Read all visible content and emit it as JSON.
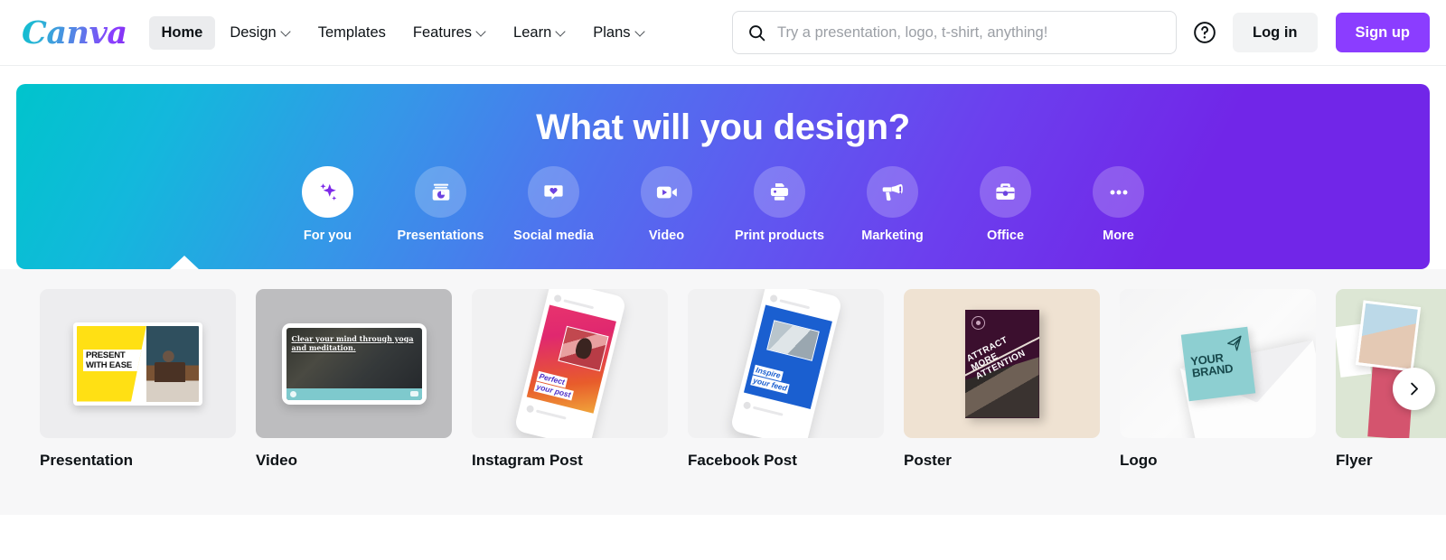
{
  "brand": {
    "logo_text": "Canva",
    "accent_purple": "#8B3DFF",
    "accent_teal": "#00C4CC"
  },
  "header": {
    "nav": [
      {
        "label": "Home",
        "has_caret": false,
        "active": true
      },
      {
        "label": "Design",
        "has_caret": true,
        "active": false
      },
      {
        "label": "Templates",
        "has_caret": false,
        "active": false
      },
      {
        "label": "Features",
        "has_caret": true,
        "active": false
      },
      {
        "label": "Learn",
        "has_caret": true,
        "active": false
      },
      {
        "label": "Plans",
        "has_caret": true,
        "active": false
      }
    ],
    "search": {
      "placeholder": "Try a presentation, logo, t-shirt, anything!",
      "value": "",
      "icon": "search-icon"
    },
    "help_icon": "help-circle-icon",
    "login_label": "Log in",
    "signup_label": "Sign up"
  },
  "hero": {
    "title": "What will you design?",
    "gradient_from": "#00C4CC",
    "gradient_to": "#7126E8",
    "categories": [
      {
        "label": "For you",
        "icon": "sparkle-icon",
        "active": true
      },
      {
        "label": "Presentations",
        "icon": "presentation-icon",
        "active": false
      },
      {
        "label": "Social media",
        "icon": "heart-bubble-icon",
        "active": false
      },
      {
        "label": "Video",
        "icon": "video-camera-icon",
        "active": false
      },
      {
        "label": "Print products",
        "icon": "printer-icon",
        "active": false
      },
      {
        "label": "Marketing",
        "icon": "megaphone-icon",
        "active": false
      },
      {
        "label": "Office",
        "icon": "briefcase-icon",
        "active": false
      },
      {
        "label": "More",
        "icon": "ellipsis-icon",
        "active": false
      }
    ]
  },
  "cards": [
    {
      "label": "Presentation",
      "art": "present-with-ease",
      "art_text": "PRESENT WITH EASE"
    },
    {
      "label": "Video",
      "art": "yoga-video",
      "art_text": "Clear your mind through yoga and meditation."
    },
    {
      "label": "Instagram Post",
      "art": "instagram-phone",
      "art_text": "Perfect your post"
    },
    {
      "label": "Facebook Post",
      "art": "facebook-phone",
      "art_text": "Inspire your feed"
    },
    {
      "label": "Poster",
      "art": "attention-poster",
      "art_text": "ATTRACT MORE ATTENTION"
    },
    {
      "label": "Logo",
      "art": "your-brand-logo",
      "art_text": "YOUR BRAND"
    },
    {
      "label": "Flyer",
      "art": "flyer-collage",
      "art_text": ""
    }
  ],
  "carousel": {
    "next_icon": "chevron-right-icon"
  }
}
